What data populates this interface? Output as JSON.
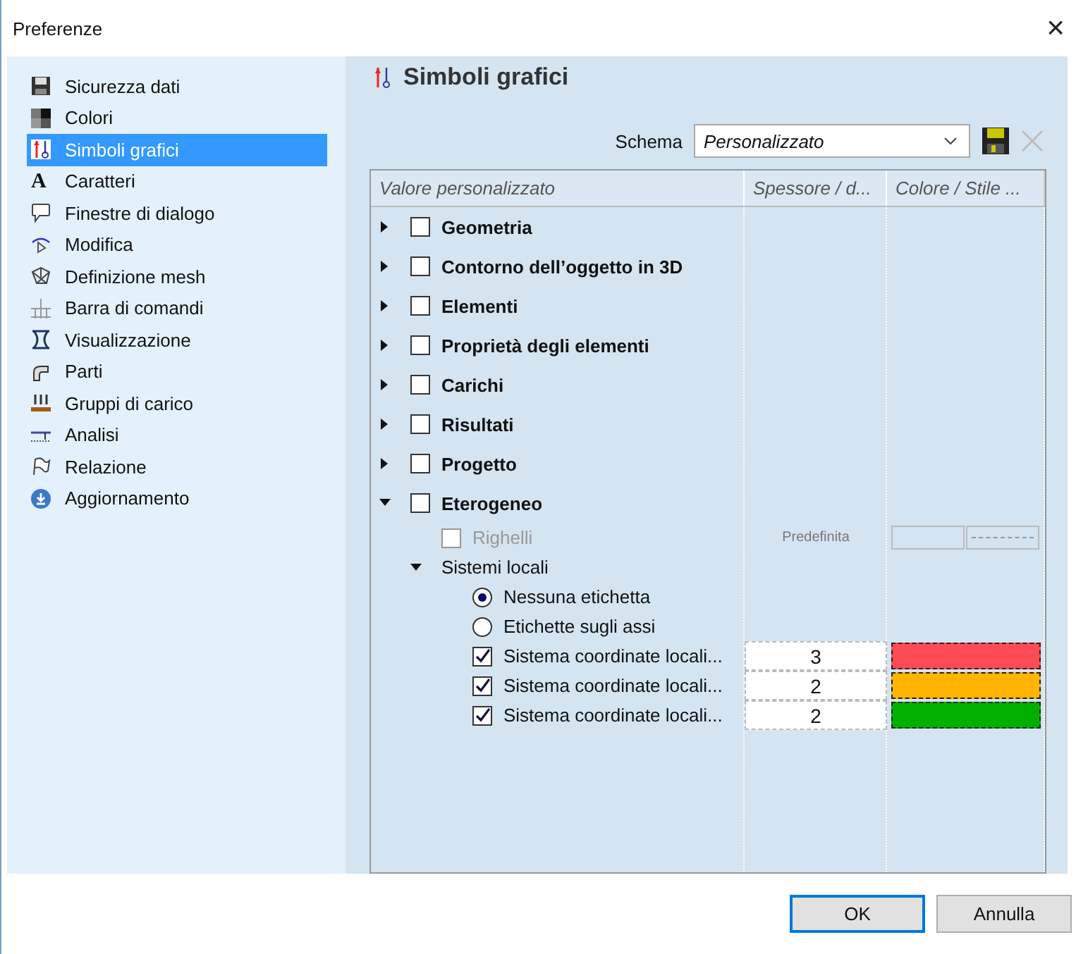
{
  "window": {
    "title": "Preferenze",
    "close": "×"
  },
  "sidebar": {
    "items": [
      {
        "label": "Sicurezza dati",
        "selected": false
      },
      {
        "label": "Colori",
        "selected": false
      },
      {
        "label": "Simboli grafici",
        "selected": true
      },
      {
        "label": "Caratteri",
        "selected": false,
        "glyph": "A"
      },
      {
        "label": "Finestre di dialogo",
        "selected": false
      },
      {
        "label": "Modifica",
        "selected": false
      },
      {
        "label": "Definizione mesh",
        "selected": false
      },
      {
        "label": "Barra di comandi",
        "selected": false
      },
      {
        "label": "Visualizzazione",
        "selected": false
      },
      {
        "label": "Parti",
        "selected": false
      },
      {
        "label": "Gruppi di carico",
        "selected": false
      },
      {
        "label": "Analisi",
        "selected": false
      },
      {
        "label": "Relazione",
        "selected": false
      },
      {
        "label": "Aggiornamento",
        "selected": false
      }
    ]
  },
  "page": {
    "title": "Simboli grafici",
    "scheme_label": "Schema",
    "scheme_value": "Personalizzato"
  },
  "tree": {
    "columns": [
      "Valore personalizzato",
      "Spessore / d...",
      "Colore / Stile ..."
    ],
    "rows": [
      {
        "kind": "group",
        "label": "Geometria",
        "expanded": false,
        "checked": false
      },
      {
        "kind": "group",
        "label": "Contorno dell’oggetto in 3D",
        "expanded": false,
        "checked": false
      },
      {
        "kind": "group",
        "label": "Elementi",
        "expanded": false,
        "checked": false
      },
      {
        "kind": "group",
        "label": "Proprietà degli elementi",
        "expanded": false,
        "checked": false
      },
      {
        "kind": "group",
        "label": "Carichi",
        "expanded": false,
        "checked": false
      },
      {
        "kind": "group",
        "label": "Risultati",
        "expanded": false,
        "checked": false
      },
      {
        "kind": "group",
        "label": "Progetto",
        "expanded": false,
        "checked": false
      },
      {
        "kind": "group",
        "label": "Eterogeneo",
        "expanded": true,
        "checked": false,
        "children": [
          {
            "kind": "check",
            "label": "Righelli",
            "checked": false,
            "disabled": true,
            "thickness": "Predefinita"
          },
          {
            "kind": "folder",
            "label": "Sistemi locali",
            "expanded": true,
            "children": [
              {
                "kind": "radio",
                "label": "Nessuna etichetta",
                "selected": true
              },
              {
                "kind": "radio",
                "label": "Etichette sugli assi",
                "selected": false
              },
              {
                "kind": "check",
                "label": "Sistema coordinate locali...",
                "checked": true,
                "disabled": false,
                "thickness": "3",
                "color": "#ff4b55"
              },
              {
                "kind": "check",
                "label": "Sistema coordinate locali...",
                "checked": true,
                "disabled": false,
                "thickness": "2",
                "color": "#ffb400"
              },
              {
                "kind": "check",
                "label": "Sistema coordinate locali...",
                "checked": true,
                "disabled": false,
                "thickness": "2",
                "color": "#00b000"
              }
            ]
          }
        ]
      }
    ]
  },
  "buttons": [
    {
      "label": "OK",
      "default": true
    },
    {
      "label": "Annulla",
      "default": false
    }
  ]
}
